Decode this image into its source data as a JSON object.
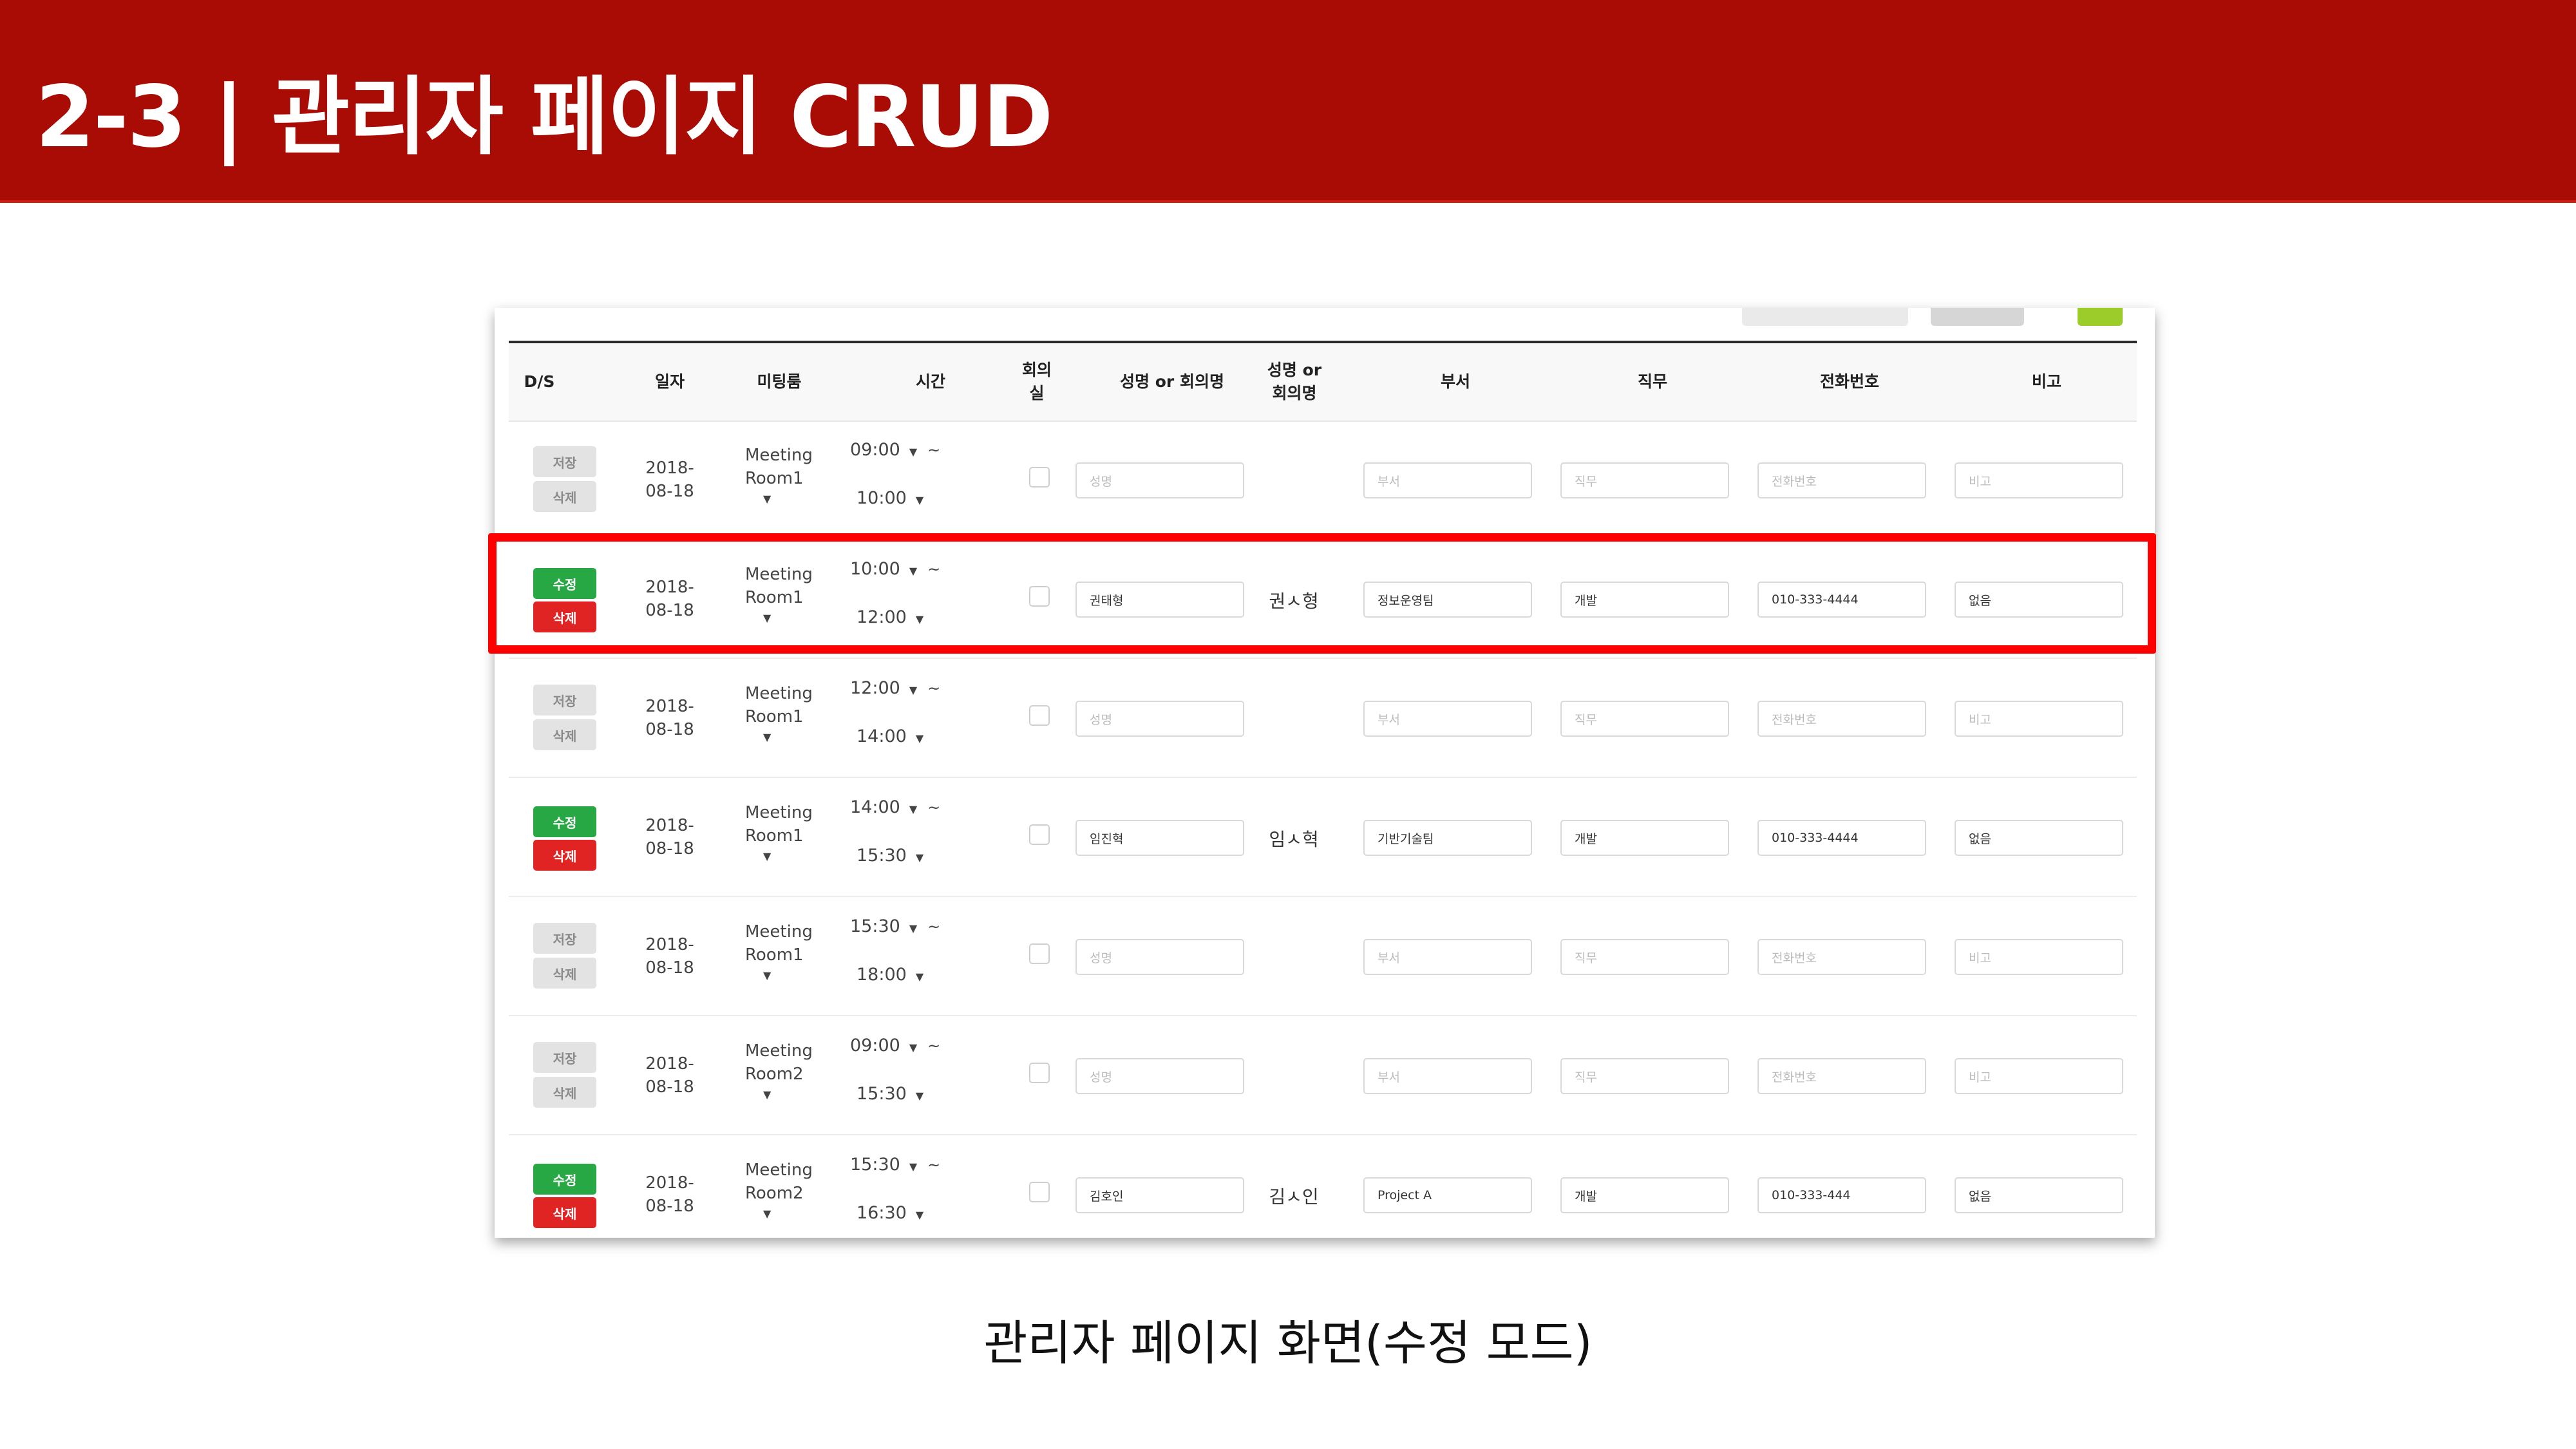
{
  "slide": {
    "title": "2-3 | 관리자 페이지 CRUD",
    "caption": "관리자 페이지 화면(수정 모드)",
    "colors": {
      "title_bar": "#a80c04",
      "highlight": "#ff0000",
      "edit_button": "#27a844",
      "delete_button": "#e02424"
    }
  },
  "table": {
    "headers": {
      "ds": "D/S",
      "date": "일자",
      "room": "미팅룸",
      "time": "시간",
      "meeting_room_line1": "회의",
      "meeting_room_line2": "실",
      "name": "성명 or 회의명",
      "name2_line1": "성명 or",
      "name2_line2": "회의명",
      "dept": "부서",
      "job": "직무",
      "phone": "전화번호",
      "note": "비고"
    },
    "placeholders": {
      "name": "성명",
      "dept": "부서",
      "job": "직무",
      "phone": "전화번호",
      "note": "비고"
    },
    "button_labels": {
      "save": "저장",
      "delete": "삭제",
      "edit": "수정"
    },
    "rows": [
      {
        "mode": "save",
        "date1": "2018-",
        "date2": "08-18",
        "room1": "Meeting",
        "room2": "Room1",
        "start": "09:00",
        "end": "10:00",
        "name": "",
        "display_name": "",
        "dept": "",
        "job": "",
        "phone": "",
        "note": ""
      },
      {
        "mode": "edit",
        "date1": "2018-",
        "date2": "08-18",
        "room1": "Meeting",
        "room2": "Room1",
        "start": "10:00",
        "end": "12:00",
        "name": "권태형",
        "display_name": "권ㅅ형",
        "dept": "정보운영팀",
        "job": "개발",
        "phone": "010-333-4444",
        "note": "없음"
      },
      {
        "mode": "save",
        "date1": "2018-",
        "date2": "08-18",
        "room1": "Meeting",
        "room2": "Room1",
        "start": "12:00",
        "end": "14:00",
        "name": "",
        "display_name": "",
        "dept": "",
        "job": "",
        "phone": "",
        "note": ""
      },
      {
        "mode": "edit",
        "date1": "2018-",
        "date2": "08-18",
        "room1": "Meeting",
        "room2": "Room1",
        "start": "14:00",
        "end": "15:30",
        "name": "임진혁",
        "display_name": "임ㅅ혁",
        "dept": "기반기술팀",
        "job": "개발",
        "phone": "010-333-4444",
        "note": "없음"
      },
      {
        "mode": "save",
        "date1": "2018-",
        "date2": "08-18",
        "room1": "Meeting",
        "room2": "Room1",
        "start": "15:30",
        "end": "18:00",
        "name": "",
        "display_name": "",
        "dept": "",
        "job": "",
        "phone": "",
        "note": ""
      },
      {
        "mode": "save",
        "date1": "2018-",
        "date2": "08-18",
        "room1": "Meeting",
        "room2": "Room2",
        "start": "09:00",
        "end": "15:30",
        "name": "",
        "display_name": "",
        "dept": "",
        "job": "",
        "phone": "",
        "note": ""
      },
      {
        "mode": "edit",
        "date1": "2018-",
        "date2": "08-18",
        "room1": "Meeting",
        "room2": "Room2",
        "start": "15:30",
        "end": "16:30",
        "name": "김호인",
        "display_name": "김ㅅ인",
        "dept": "Project A",
        "job": "개발",
        "phone": "010-333-444",
        "note": "없음"
      }
    ]
  }
}
